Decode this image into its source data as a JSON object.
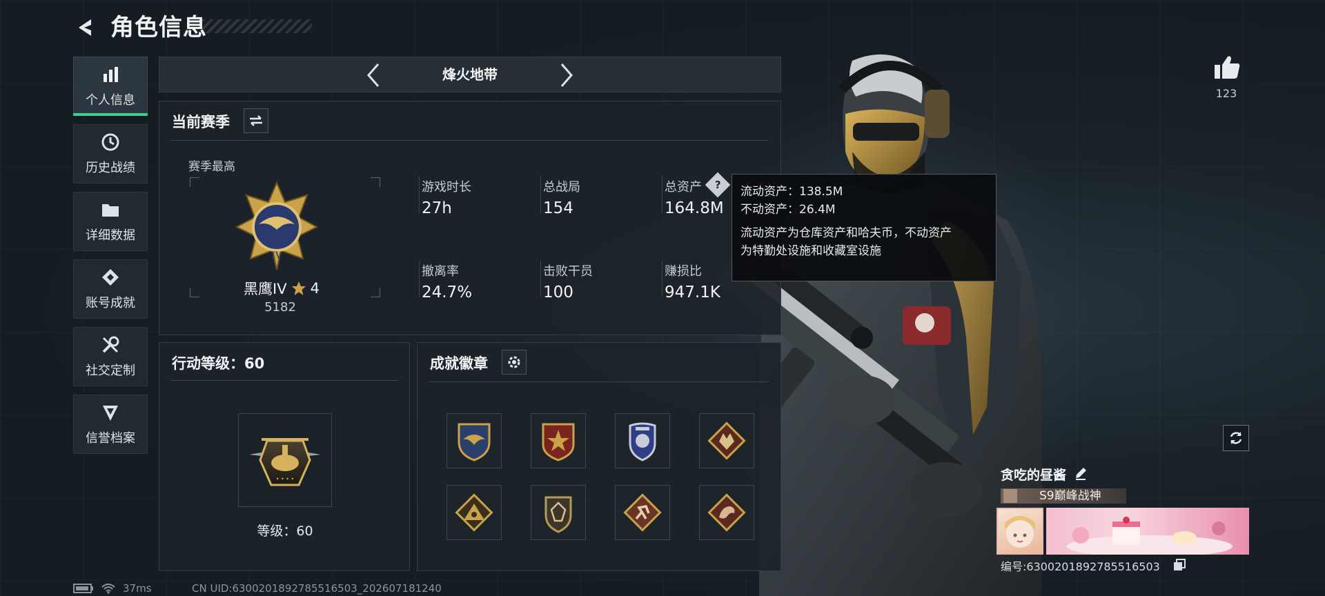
{
  "header": {
    "title": "角色信息"
  },
  "sidebar": {
    "items": [
      {
        "label": "个人信息",
        "icon": "bar-chart-icon",
        "active": true
      },
      {
        "label": "历史战绩",
        "icon": "clock-icon",
        "active": false
      },
      {
        "label": "详细数据",
        "icon": "folder-icon",
        "active": false
      },
      {
        "label": "账号成就",
        "icon": "achievement-icon",
        "active": false
      },
      {
        "label": "社交定制",
        "icon": "wrench-icon",
        "active": false
      },
      {
        "label": "信誉档案",
        "icon": "shield-emblem-icon",
        "active": false
      }
    ]
  },
  "mode": {
    "title": "烽火地带"
  },
  "season": {
    "title": "当前赛季",
    "best_label": "赛季最高",
    "rank_name": "黑鹰IV",
    "rank_stars": "4",
    "rank_score": "5182",
    "stats": [
      {
        "label": "游戏时长",
        "value": "27h"
      },
      {
        "label": "总战局",
        "value": "154"
      },
      {
        "label": "总资产",
        "value": "164.8M"
      },
      {
        "label": "撤离率",
        "value": "24.7%"
      },
      {
        "label": "击败干员",
        "value": "100"
      },
      {
        "label": "赚损比",
        "value": "947.1K"
      }
    ]
  },
  "tooltip": {
    "line1": "流动资产：138.5M",
    "line2": "不动资产：26.4M",
    "desc1": "流动资产为仓库资产和哈夫币，不动资产",
    "desc2": "为特勤处设施和收藏室设施"
  },
  "level": {
    "title": "行动等级：60",
    "level_text": "等级：60"
  },
  "badges": {
    "title": "成就徽章",
    "items": [
      "eagle-shield-badge-icon",
      "star-crest-badge-icon",
      "police-badge-icon",
      "wolf-badge-icon",
      "triangle-eye-badge-icon",
      "gem-shield-badge-icon",
      "runner-badge-icon",
      "dragon-badge-icon"
    ]
  },
  "profile": {
    "likes": "123",
    "name": "贪吃的昼酱",
    "title_tag": "S9巅峰战神",
    "id_text": "编号:6300201892785516503"
  },
  "footer": {
    "ping": "37ms",
    "uid": "CN UID:6300201892785516503_202607181240"
  },
  "colors": {
    "accent": "#3ccf8e",
    "gold": "#c9a24a",
    "panel": "#1c2329"
  }
}
